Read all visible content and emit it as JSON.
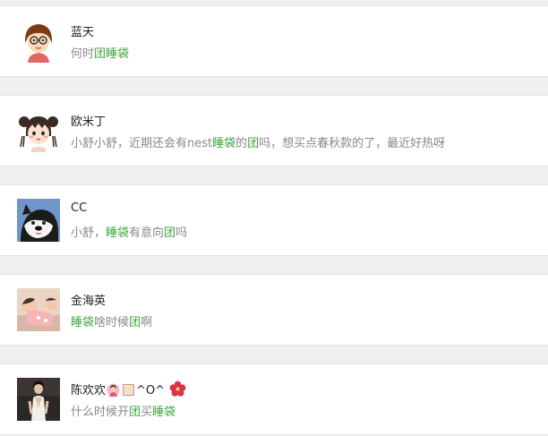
{
  "comments": [
    {
      "name": "蓝天",
      "avatar_icon": "cartoon-girl-glasses-avatar",
      "segments": [
        {
          "text": "何时",
          "highlight": false
        },
        {
          "text": "团",
          "highlight": true
        },
        {
          "text": "睡袋",
          "highlight": true
        }
      ]
    },
    {
      "name": "欧米丁",
      "avatar_icon": "cartoon-girl-pigtails-avatar",
      "segments": [
        {
          "text": "小舒小舒，近期还会有nest",
          "highlight": false
        },
        {
          "text": "睡袋",
          "highlight": true
        },
        {
          "text": "的",
          "highlight": false
        },
        {
          "text": "团",
          "highlight": true
        },
        {
          "text": "吗，想买点春秋款的了，最近好热呀",
          "highlight": false
        }
      ]
    },
    {
      "name": "CC",
      "avatar_icon": "husky-dog-avatar",
      "segments": [
        {
          "text": "小舒，",
          "highlight": false
        },
        {
          "text": "睡袋",
          "highlight": true
        },
        {
          "text": "有意向",
          "highlight": false
        },
        {
          "text": "团",
          "highlight": true
        },
        {
          "text": "吗",
          "highlight": false
        }
      ]
    },
    {
      "name": "金海英",
      "avatar_icon": "sleeping-baby-photo-avatar",
      "segments": [
        {
          "text": "睡袋",
          "highlight": true
        },
        {
          "text": "啥时候",
          "highlight": false
        },
        {
          "text": "团",
          "highlight": true
        },
        {
          "text": "啊",
          "highlight": false
        }
      ]
    },
    {
      "name_prefix": "陈欢欢",
      "name_emojis": [
        "woman-gesturing-emoji",
        "square-frame-emoji"
      ],
      "name_middle": "^O^",
      "name_suffix_emoji": "hibiscus-flower-emoji",
      "avatar_icon": "woman-portrait-photo-avatar",
      "segments": [
        {
          "text": "什么时候开",
          "highlight": false
        },
        {
          "text": "团",
          "highlight": true
        },
        {
          "text": "买",
          "highlight": false
        },
        {
          "text": "睡袋",
          "highlight": true
        }
      ]
    }
  ],
  "colors": {
    "highlight": "#3da53d",
    "message": "#888888",
    "name": "#222222",
    "background": "#f0f0f0"
  }
}
